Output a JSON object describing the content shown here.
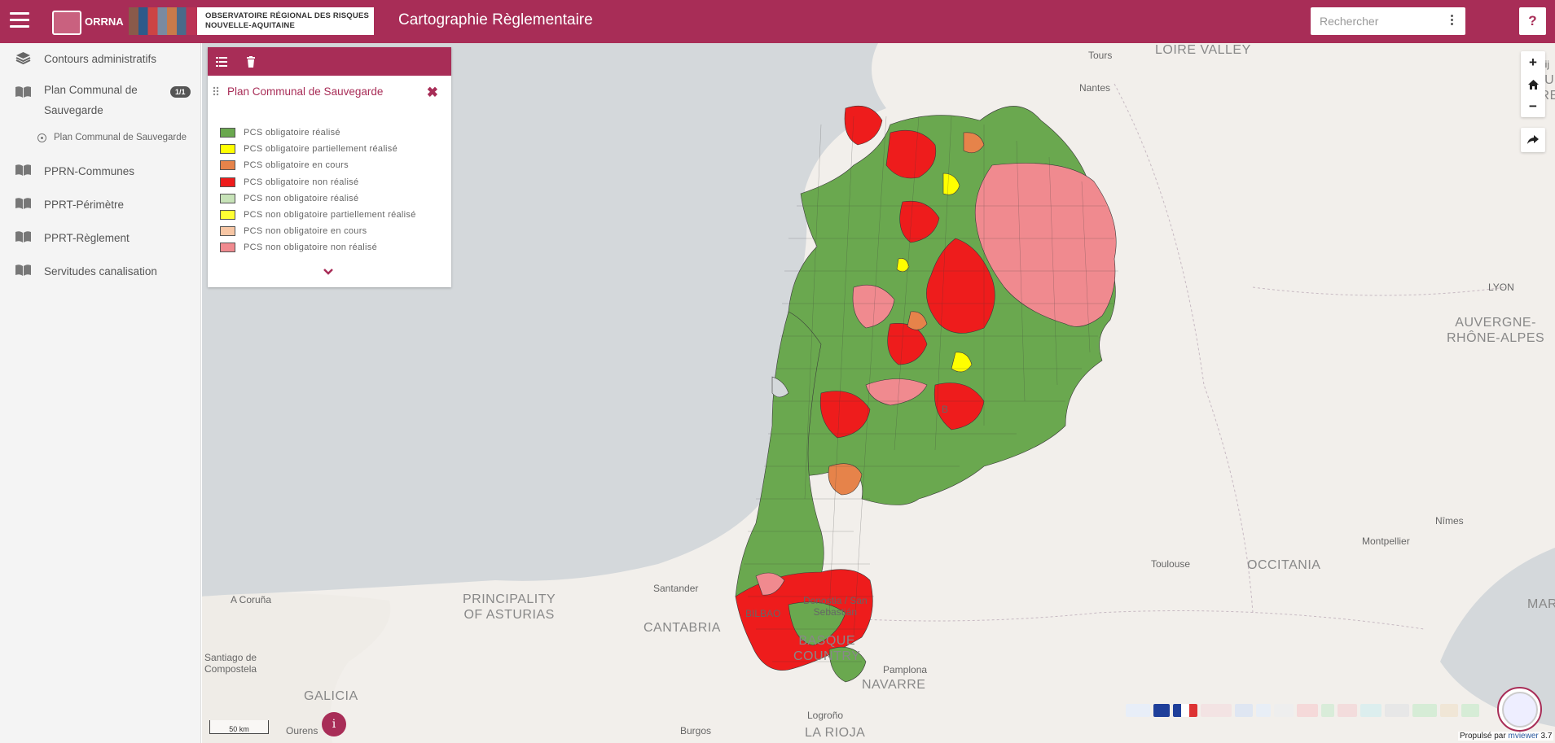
{
  "header": {
    "app_title": "Cartographie Règlementaire",
    "logo": {
      "acronym": "ORRNA",
      "line1": "OBSERVATOIRE RÉGIONAL DES RISQUES",
      "line2": "NOUVELLE-AQUITAINE"
    },
    "search_placeholder": "Rechercher",
    "help_label": "?"
  },
  "sidebar": {
    "items": [
      {
        "label": "Contours administratifs",
        "icon": "layers-icon"
      },
      {
        "label": "Plan Communal de Sauvegarde",
        "icon": "book-icon",
        "badge": "1/1"
      },
      {
        "label": "PPRN-Communes",
        "icon": "book-icon"
      },
      {
        "label": "PPRT-Périmètre",
        "icon": "book-icon"
      },
      {
        "label": "PPRT-Règlement",
        "icon": "book-icon"
      },
      {
        "label": "Servitudes canalisation",
        "icon": "book-icon"
      }
    ],
    "sub_item": "Plan Communal de Sauvegarde"
  },
  "legend": {
    "title": "Plan Communal de Sauvegarde",
    "items": [
      {
        "label": "PCS obligatoire réalisé",
        "color": "#6aa84f"
      },
      {
        "label": "PCS obligatoire partiellement réalisé",
        "color": "#ffff00"
      },
      {
        "label": "PCS obligatoire en cours",
        "color": "#e6834a"
      },
      {
        "label": "PCS obligatoire non réalisé",
        "color": "#ee1c1c"
      },
      {
        "label": "PCS non obligatoire réalisé",
        "color": "#c7e3b8"
      },
      {
        "label": "PCS non obligatoire partiellement réalisé",
        "color": "#ffff33"
      },
      {
        "label": "PCS non obligatoire en cours",
        "color": "#f7c6a4"
      },
      {
        "label": "PCS non obligatoire non réalisé",
        "color": "#f08a8f"
      }
    ]
  },
  "map": {
    "labels": {
      "loire_valley": "LOIRE VALLEY",
      "tours": "Tours",
      "nantes": "Nantes",
      "bourgogne": "BOURG\nFREE",
      "dijon": "Dij",
      "lyon": "LYON",
      "auvergne": "AUVERGNE-\nRHÔNE-ALPES",
      "nimes": "Nîmes",
      "montpellier": "Montpellier",
      "occitania": "OCCITANIA",
      "toulouse": "Toulouse",
      "marseille": "MARSEILL",
      "asturias": "PRINCIPALITY\nOF ASTURIAS",
      "cantabria": "CANTABRIA",
      "santander": "Santander",
      "bilbao": "BILBAO",
      "donostia": "Donostia / San\nSebastián",
      "basque": "BASQUE\nCOUNTRY",
      "navarre": "NAVARRE",
      "pamplona": "Pamplona",
      "acoruna": "A Coruña",
      "santiago": "Santiago de\nCompostela",
      "galicia": "GALICIA",
      "ourense": "Ourens",
      "burgos": "Burgos",
      "logrono": "Logroño",
      "larioja": "LA RIOJA",
      "b_cut": "B"
    },
    "scale_label": "50 km",
    "info_label": "i",
    "attribution_prefix": "Propulsé par",
    "attribution_link": "mviewer",
    "attribution_version": "3.7",
    "ocean_color": "#d4d8db",
    "land_color": "#f2efeb"
  }
}
